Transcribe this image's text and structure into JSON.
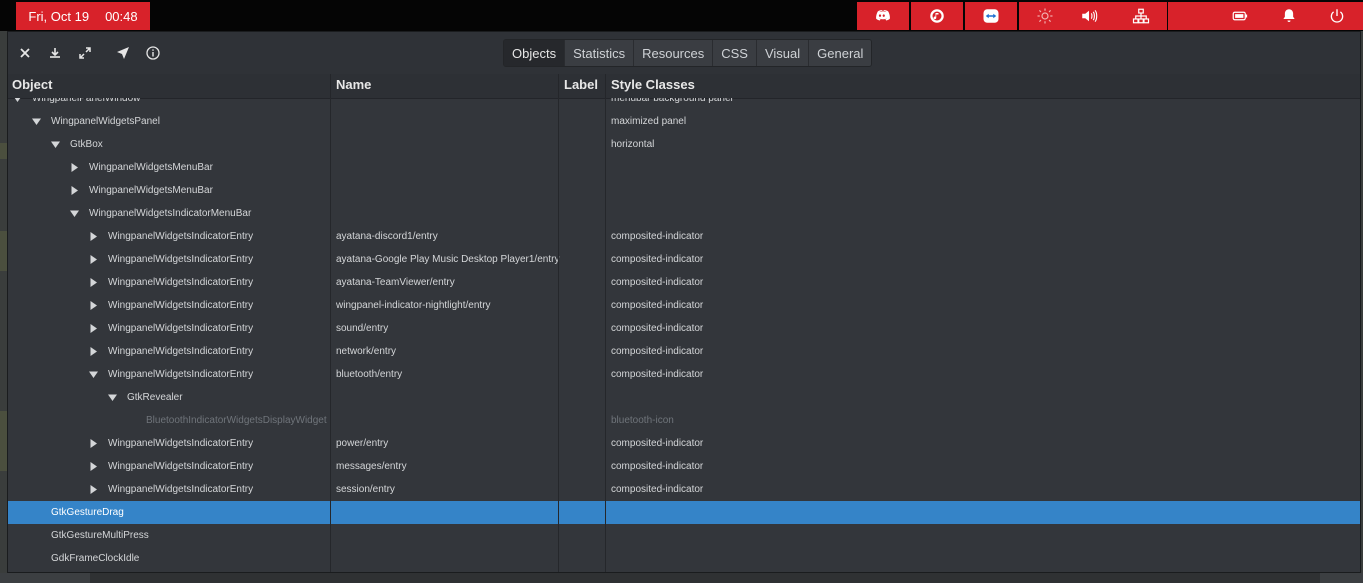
{
  "panel": {
    "date": "Fri, Oct 19",
    "time": "00:48",
    "indicators": [
      {
        "name": "discord-icon"
      },
      {
        "name": "music-player-icon"
      },
      {
        "name": "teamviewer-icon"
      },
      {
        "name": "nightlight-icon"
      },
      {
        "name": "volume-icon"
      },
      {
        "name": "network-icon"
      },
      {
        "name": "bluetooth-icon"
      },
      {
        "name": "battery-icon"
      },
      {
        "name": "notifications-icon"
      },
      {
        "name": "power-icon"
      }
    ],
    "accent": "#d8222a"
  },
  "toolbar": {
    "buttons": [
      "close-icon",
      "download-icon",
      "fullscreen-icon",
      "pick-icon",
      "info-icon"
    ],
    "tabs": [
      "Objects",
      "Statistics",
      "Resources",
      "CSS",
      "Visual",
      "General"
    ],
    "active_tab": "Objects"
  },
  "columns": {
    "object": "Object",
    "name": "Name",
    "label": "Label",
    "style": "Style Classes"
  },
  "rows": [
    {
      "object": "WingpanelPanelWindow",
      "name": "",
      "label": "",
      "style": "menubar background panel",
      "expander": "open"
    },
    {
      "object": "WingpanelWidgetsPanel",
      "name": "",
      "label": "",
      "style": "maximized panel",
      "expander": "open"
    },
    {
      "object": "GtkBox",
      "name": "",
      "label": "",
      "style": "horizontal",
      "expander": "open"
    },
    {
      "object": "WingpanelWidgetsMenuBar",
      "name": "",
      "label": "",
      "style": "",
      "expander": "closed"
    },
    {
      "object": "WingpanelWidgetsMenuBar",
      "name": "",
      "label": "",
      "style": "",
      "expander": "closed"
    },
    {
      "object": "WingpanelWidgetsIndicatorMenuBar",
      "name": "",
      "label": "",
      "style": "",
      "expander": "open"
    },
    {
      "object": "WingpanelWidgetsIndicatorEntry",
      "name": "ayatana-discord1/entry",
      "label": "",
      "style": "composited-indicator",
      "expander": "closed"
    },
    {
      "object": "WingpanelWidgetsIndicatorEntry",
      "name": "ayatana-Google Play Music Desktop Player1/entry",
      "label": "",
      "style": "composited-indicator",
      "expander": "closed"
    },
    {
      "object": "WingpanelWidgetsIndicatorEntry",
      "name": "ayatana-TeamViewer/entry",
      "label": "",
      "style": "composited-indicator",
      "expander": "closed"
    },
    {
      "object": "WingpanelWidgetsIndicatorEntry",
      "name": "wingpanel-indicator-nightlight/entry",
      "label": "",
      "style": "composited-indicator",
      "expander": "closed"
    },
    {
      "object": "WingpanelWidgetsIndicatorEntry",
      "name": "sound/entry",
      "label": "",
      "style": "composited-indicator",
      "expander": "closed"
    },
    {
      "object": "WingpanelWidgetsIndicatorEntry",
      "name": "network/entry",
      "label": "",
      "style": "composited-indicator",
      "expander": "closed"
    },
    {
      "object": "WingpanelWidgetsIndicatorEntry",
      "name": "bluetooth/entry",
      "label": "",
      "style": "composited-indicator",
      "expander": "open"
    },
    {
      "object": "GtkRevealer",
      "name": "",
      "label": "",
      "style": "",
      "expander": "open"
    },
    {
      "object": "BluetoothIndicatorWidgetsDisplayWidget",
      "name": "",
      "label": "",
      "style": "bluetooth-icon",
      "expander": "none",
      "dim": true
    },
    {
      "object": "WingpanelWidgetsIndicatorEntry",
      "name": "power/entry",
      "label": "",
      "style": "composited-indicator",
      "expander": "closed"
    },
    {
      "object": "WingpanelWidgetsIndicatorEntry",
      "name": "messages/entry",
      "label": "",
      "style": "composited-indicator",
      "expander": "closed"
    },
    {
      "object": "WingpanelWidgetsIndicatorEntry",
      "name": "session/entry",
      "label": "",
      "style": "composited-indicator",
      "expander": "closed"
    },
    {
      "object": "GtkGestureDrag",
      "name": "",
      "label": "",
      "style": "",
      "expander": "none",
      "selected": true
    },
    {
      "object": "GtkGestureMultiPress",
      "name": "",
      "label": "",
      "style": "",
      "expander": "none"
    },
    {
      "object": "GdkFrameClockIdle",
      "name": "",
      "label": "",
      "style": "",
      "expander": "none"
    }
  ],
  "selection_color": "#3584c8"
}
